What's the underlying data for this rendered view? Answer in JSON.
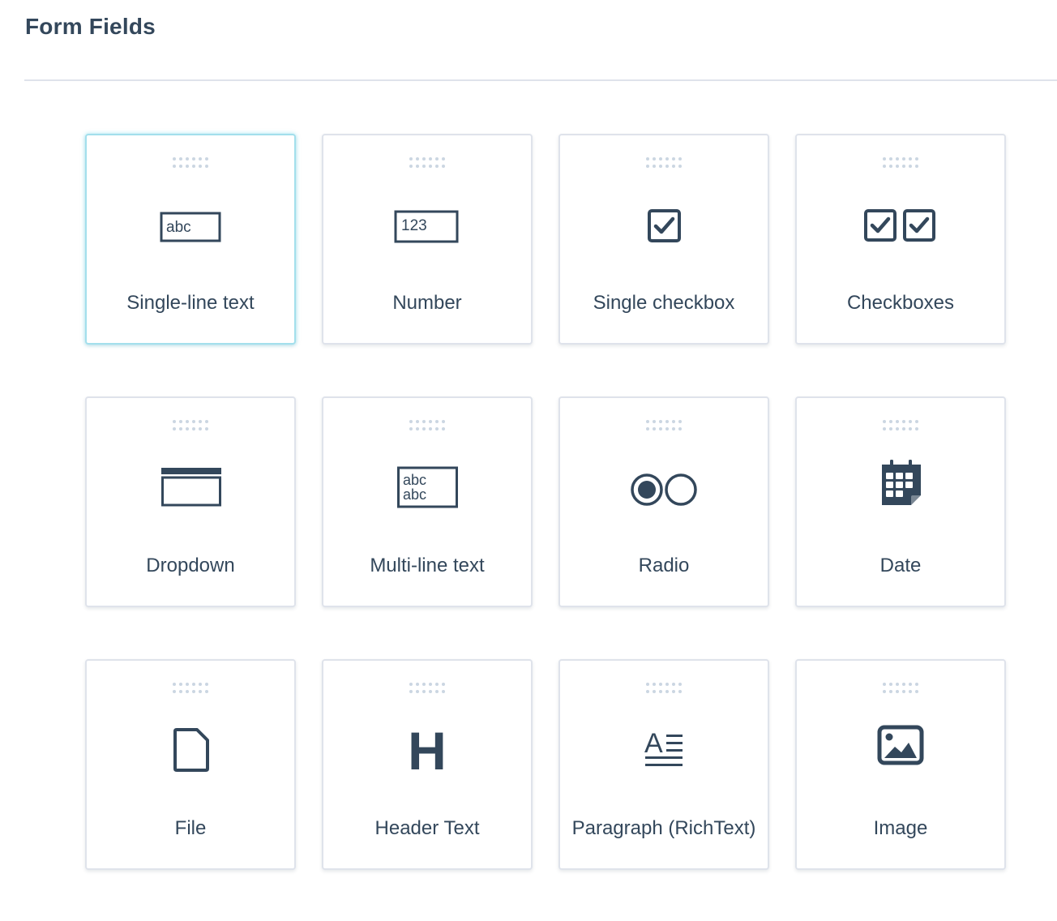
{
  "header": {
    "title": "Form Fields"
  },
  "fields": [
    {
      "label": "Single-line text",
      "icon": "single-line-text-icon",
      "icon_text": "abc",
      "selected": true
    },
    {
      "label": "Number",
      "icon": "number-icon",
      "icon_text": "123"
    },
    {
      "label": "Single checkbox",
      "icon": "single-checkbox-icon"
    },
    {
      "label": "Checkboxes",
      "icon": "checkboxes-icon"
    },
    {
      "label": "Dropdown",
      "icon": "dropdown-icon"
    },
    {
      "label": "Multi-line text",
      "icon": "multi-line-text-icon",
      "icon_text": "abc"
    },
    {
      "label": "Radio",
      "icon": "radio-icon"
    },
    {
      "label": "Date",
      "icon": "calendar-icon"
    },
    {
      "label": "File",
      "icon": "file-icon"
    },
    {
      "label": "Header Text",
      "icon": "header-icon",
      "icon_text": "H"
    },
    {
      "label": "Paragraph (RichText)",
      "icon": "paragraph-icon",
      "icon_text": "A"
    },
    {
      "label": "Image",
      "icon": "image-icon"
    }
  ],
  "colors": {
    "text": "#33475b",
    "border": "#dfe3eb",
    "selected_border": "#a3dfec",
    "handle_dots": "#cbd6e2"
  }
}
